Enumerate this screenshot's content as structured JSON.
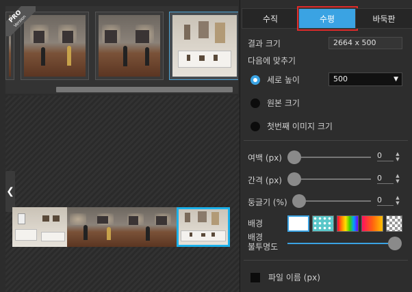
{
  "tabs": [
    {
      "label": "수직",
      "active": false
    },
    {
      "label": "수평",
      "active": true
    },
    {
      "label": "바둑판",
      "active": false
    }
  ],
  "badge": {
    "line1": "PRO",
    "line2": "Version"
  },
  "result_size": {
    "label": "결과 크기",
    "value": "2664 x 500"
  },
  "fit": {
    "label": "다음에 맞추기",
    "options": [
      {
        "label": "세로 높이",
        "selected": true
      },
      {
        "label": "원본 크기",
        "selected": false
      },
      {
        "label": "첫번째 이미지 크기",
        "selected": false
      }
    ],
    "height_value": "500"
  },
  "margin": {
    "label": "여백 (px)",
    "value": "0"
  },
  "spacing": {
    "label": "간격 (px)",
    "value": "0"
  },
  "rounding": {
    "label": "둥글기 (%)",
    "value": "0"
  },
  "background": {
    "label": "배경",
    "swatches": [
      "white",
      "teal-dots",
      "rainbow",
      "red-yellow-gradient",
      "transparent-checker"
    ],
    "selected": "white"
  },
  "bg_opacity": {
    "label_line1": "배경",
    "label_line2": "불투명도",
    "level": 1.0
  },
  "filename": {
    "label": "파일 이름 (px)",
    "checked": false
  },
  "icons": {
    "nav_left": "chevron-left-icon",
    "dropdown": "caret-down-icon",
    "spinner": "spinner-up-down-icon"
  },
  "colors": {
    "accent": "#3aa3e3",
    "selected_border": "#1cb1ea",
    "highlight": "#e02b2b"
  }
}
